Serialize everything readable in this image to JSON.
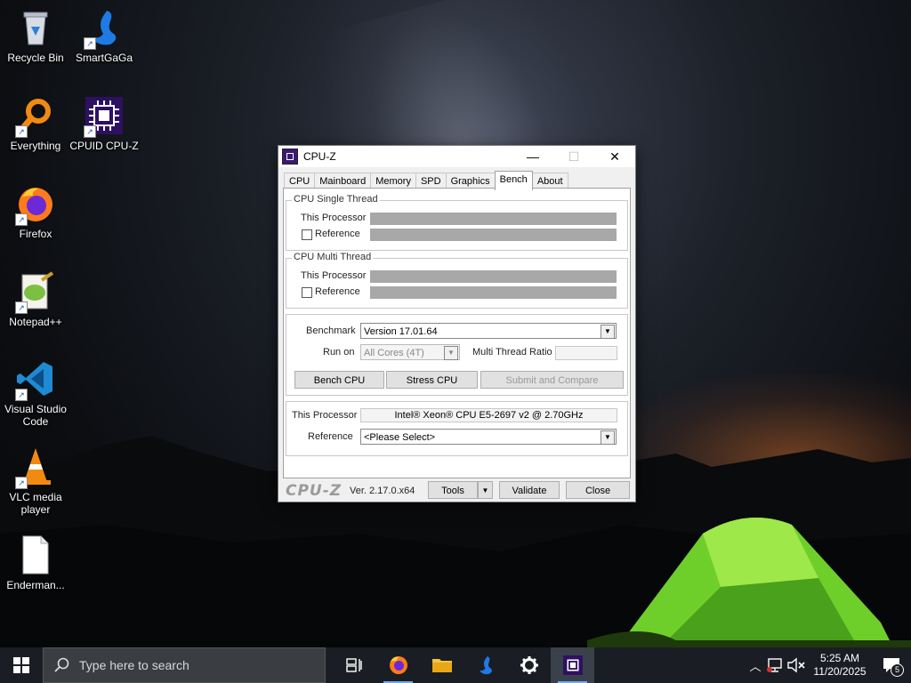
{
  "desktop": {
    "icons": [
      {
        "label": "Recycle Bin"
      },
      {
        "label": "SmartGaGa"
      },
      {
        "label": "Everything"
      },
      {
        "label": "CPUID CPU-Z"
      },
      {
        "label": "Firefox"
      },
      {
        "label": "Notepad++"
      },
      {
        "label": "Visual Studio Code"
      },
      {
        "label": "VLC media player"
      },
      {
        "label": "Enderman..."
      }
    ]
  },
  "window": {
    "title": "CPU-Z",
    "controls": {
      "minimize": "—",
      "maximize": "☐",
      "close": "✕"
    },
    "tabs": [
      "CPU",
      "Mainboard",
      "Memory",
      "SPD",
      "Graphics",
      "Bench",
      "About"
    ],
    "active_tab": "Bench",
    "single_thread": {
      "legend": "CPU Single Thread",
      "this_processor": "This Processor",
      "reference": "Reference"
    },
    "multi_thread": {
      "legend": "CPU Multi Thread",
      "this_processor": "This Processor",
      "reference": "Reference"
    },
    "benchmark": {
      "label": "Benchmark",
      "version": "Version 17.01.64",
      "run_on_label": "Run on",
      "run_on_value": "All Cores (4T)",
      "multi_thread_ratio_label": "Multi Thread Ratio",
      "bench_cpu": "Bench CPU",
      "stress_cpu": "Stress CPU",
      "submit_compare": "Submit and Compare"
    },
    "processor": {
      "label": "This Processor",
      "value": "Intel® Xeon® CPU E5-2697 v2 @ 2.70GHz",
      "reference_label": "Reference",
      "reference_value": "<Please Select>"
    },
    "footer": {
      "logo": "CPU-Z",
      "version": "Ver. 2.17.0.x64",
      "tools": "Tools",
      "validate": "Validate",
      "close": "Close"
    }
  },
  "taskbar": {
    "search_placeholder": "Type here to search",
    "time": "5:25 AM",
    "date": "11/20/2025",
    "notification_count": "5"
  },
  "colors": {
    "taskbar": "#1a1e24",
    "window_bg": "#f0f0f0",
    "bar_gray": "#a8a8a8",
    "cpuz_purple": "#3a1a6e"
  }
}
